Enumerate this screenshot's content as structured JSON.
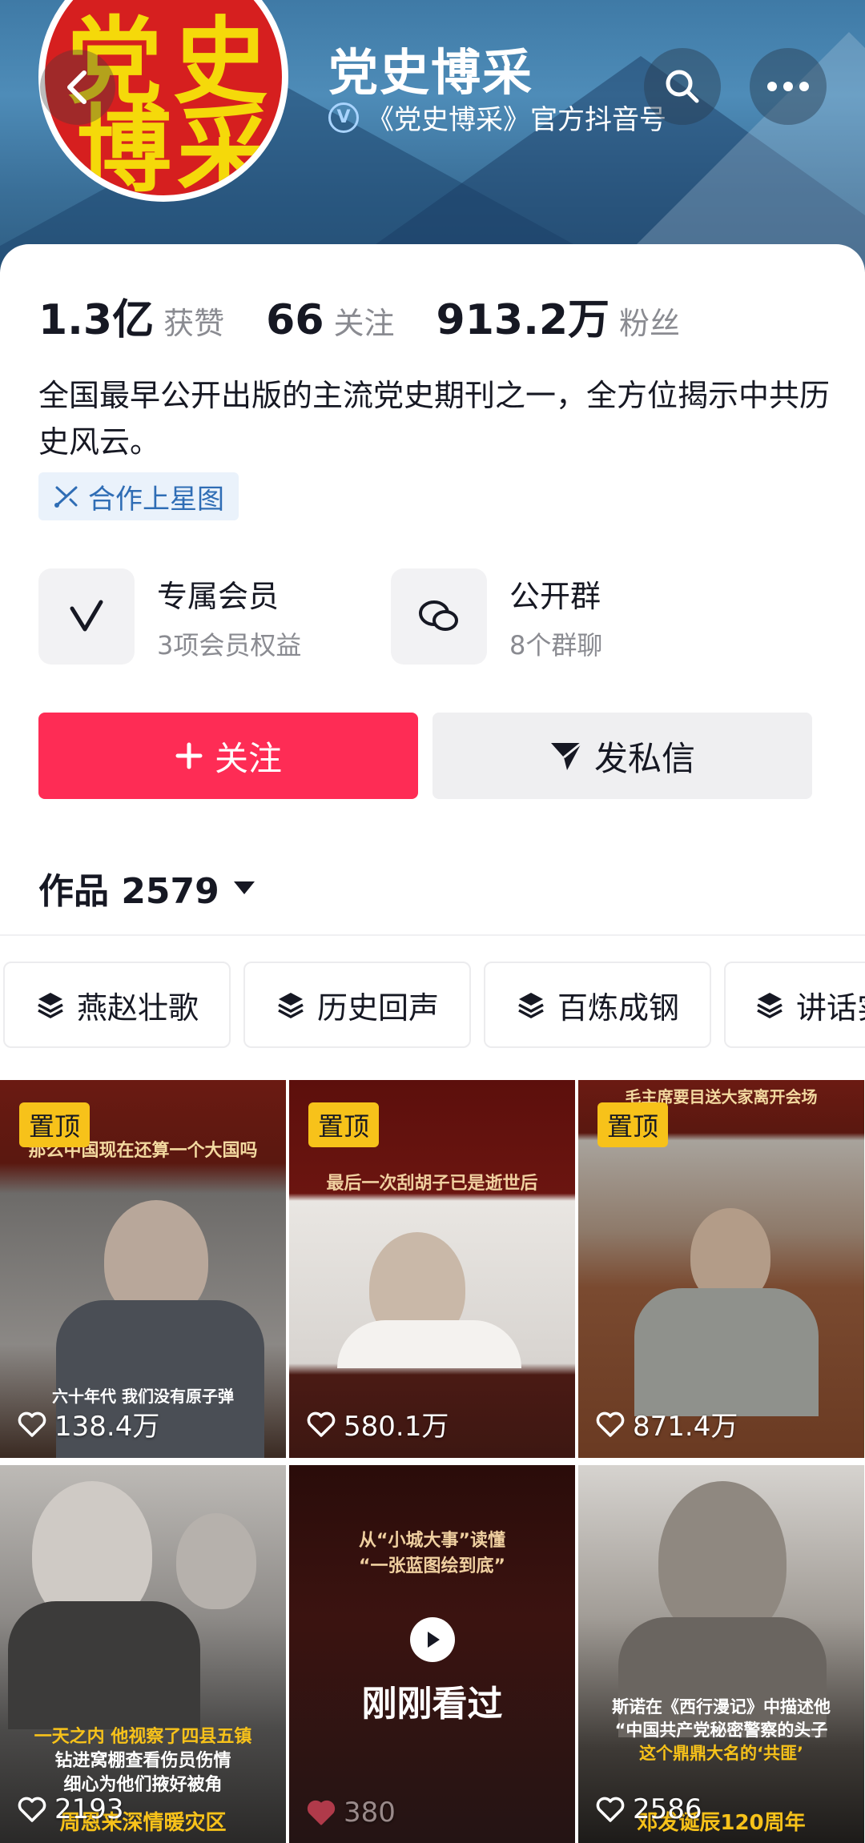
{
  "header": {
    "account_name": "党史博采",
    "verified_text": "《党史博采》官方抖音号",
    "avatar_text": [
      "党",
      "史",
      "博",
      "采"
    ]
  },
  "stats": [
    {
      "value": "1.3亿",
      "label": "获赞"
    },
    {
      "value": "66",
      "label": "关注"
    },
    {
      "value": "913.2万",
      "label": "粉丝"
    }
  ],
  "bio": "全国最早公开出版的主流党史期刊之一，全方位揭示中共历史风云。",
  "tag": "合作上星图",
  "features": [
    {
      "title": "专属会员",
      "subtitle": "3项会员权益",
      "icon": "v-icon"
    },
    {
      "title": "公开群",
      "subtitle": "8个群聊",
      "icon": "chat-bubbles-icon"
    }
  ],
  "actions": {
    "follow_label": "关注",
    "message_label": "发私信"
  },
  "works": {
    "label": "作品 2579"
  },
  "collections": [
    "燕赵壮歌",
    "历史回声",
    "百炼成钢",
    "讲话实"
  ],
  "videos": [
    {
      "pinned": "置顶",
      "likes": "138.4万",
      "top_text": "那么中国现在还算一个大国吗",
      "bottom_text": "六十年代 我们没有原子弹"
    },
    {
      "pinned": "置顶",
      "likes": "580.1万",
      "top_text": "最后一次刮胡子已是逝世后",
      "bottom_text": ""
    },
    {
      "pinned": "置顶",
      "likes": "871.4万",
      "top_text": "毛主席要目送大家离开会场",
      "bottom_text": ""
    },
    {
      "pinned": "",
      "likes": "2193",
      "top_text": "",
      "bottom_text": "一天之内 他视察了四县五镇",
      "bottom_text2": "钻进窝棚查看伤员伤情",
      "bottom_text3": "细心为他们掖好被角",
      "footer_text": "周恩来深情暖灾区"
    },
    {
      "pinned": "",
      "likes": "380",
      "top_text": "从“小城大事”读懂",
      "top_text2": "“一张蓝图绘到底”",
      "watched": "刚刚看过"
    },
    {
      "pinned": "",
      "likes": "2586",
      "top_text": "",
      "bottom_text": "斯诺在《西行漫记》中描述他",
      "bottom_text2": "“中国共产党秘密警察的头子",
      "bottom_text3": "这个鼎鼎大名的‘共匪’",
      "footer_text": "邓发诞辰120周年"
    }
  ],
  "colors": {
    "accent": "#fe2c55",
    "pin": "#f7c21a",
    "tag_blue": "#2f6db5"
  }
}
